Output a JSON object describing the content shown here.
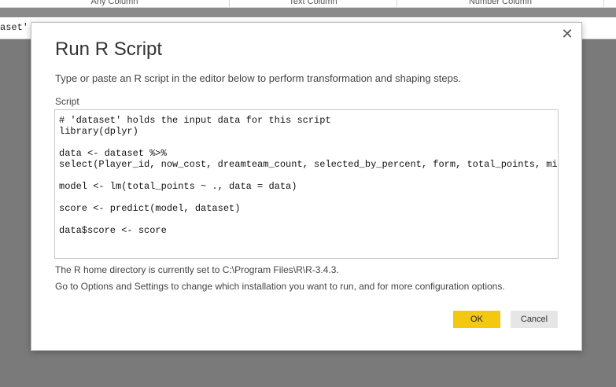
{
  "background": {
    "columns": [
      "Any Column",
      "Text Column",
      "Number Column"
    ],
    "formula_fragment": "aset'"
  },
  "dialog": {
    "title": "Run R Script",
    "close_glyph": "✕",
    "subtitle": "Type or paste an R script in the editor below to perform transformation and shaping steps.",
    "script_label": "Script",
    "script": "# 'dataset' holds the input data for this script\nlibrary(dplyr)\n\ndata <- dataset %>%\nselect(Player_id, now_cost, dreamteam_count, selected_by_percent, form, total_points, minutes)\n\nmodel <- lm(total_points ~ ., data = data)\n\nscore <- predict(model, dataset)\n\ndata$score <- score",
    "home_directory_text": "The R home directory is currently set to C:\\Program Files\\R\\R-3.4.3.",
    "options_text": "Go to Options and Settings to change which installation you want to run, and for more configuration options.",
    "ok_label": "OK",
    "cancel_label": "Cancel"
  },
  "colors": {
    "accent": "#f2c811",
    "overlay": "#7a7a7a"
  }
}
